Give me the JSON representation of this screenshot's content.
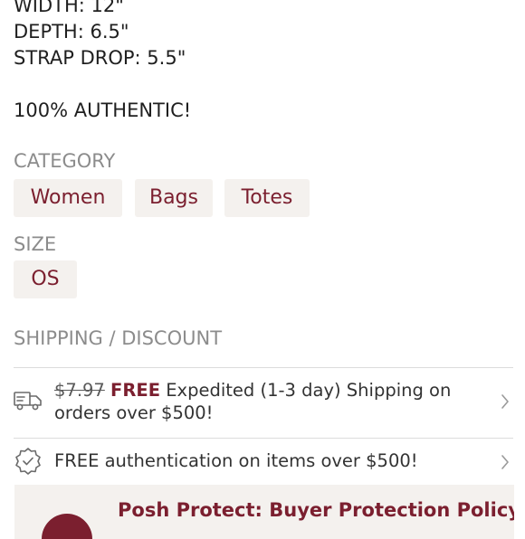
{
  "description": {
    "width": "WIDTH: 12\"",
    "depth": "DEPTH: 6.5\"",
    "strap_drop": "STRAP DROP: 5.5\"",
    "authentic": "100% AUTHENTIC!"
  },
  "category": {
    "label": "CATEGORY",
    "tags": [
      "Women",
      "Bags",
      "Totes"
    ]
  },
  "size": {
    "label": "SIZE",
    "value": "OS"
  },
  "shipping": {
    "label": "SHIPPING / DISCOUNT",
    "shipping_row": {
      "icon": "truck-icon",
      "old_price": "$7.97",
      "free": "FREE",
      "text_line1": " Expedited (1-3 day) Shipping on",
      "text_line2": "orders over $500!"
    },
    "auth_row": {
      "icon": "verified-badge-icon",
      "text": "FREE authentication on items over $500!"
    }
  },
  "protect": {
    "title": "Posh Protect: Buyer Protection Policy"
  },
  "colors": {
    "accent": "#7b1f2f",
    "chip_bg": "#f4f1ee",
    "label_gray": "#8c8c8c"
  }
}
